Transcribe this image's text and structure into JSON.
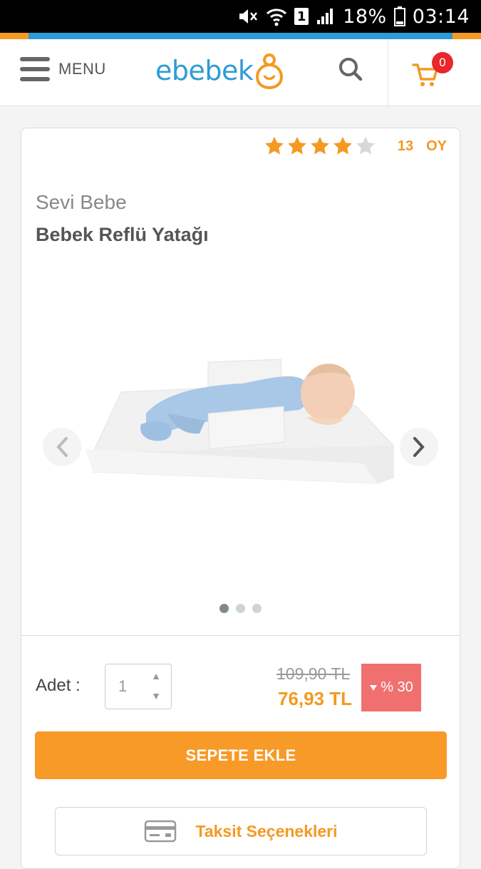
{
  "status_bar": {
    "battery": "18%",
    "time": "03:14",
    "sim": "1"
  },
  "header": {
    "menu_label": "MENU",
    "logo_text": "ebebek",
    "cart_count": "0"
  },
  "product": {
    "rating": 4,
    "rating_max": 5,
    "vote_count": "13",
    "vote_label": "OY",
    "brand": "Sevi Bebe",
    "title": "Bebek Reflü Yatağı",
    "gallery": {
      "total": 3,
      "active": 1
    }
  },
  "purchase": {
    "qty_label": "Adet :",
    "qty_value": "1",
    "old_price": "109,90 TL",
    "new_price": "76,93 TL",
    "discount": "% 30",
    "add_to_cart": "SEPETE EKLE",
    "installment": "Taksit Seçenekleri"
  },
  "colors": {
    "brand_blue": "#2e9bd6",
    "brand_orange": "#f39a22",
    "discount_red": "#f07070",
    "badge_red": "#e8262c"
  }
}
